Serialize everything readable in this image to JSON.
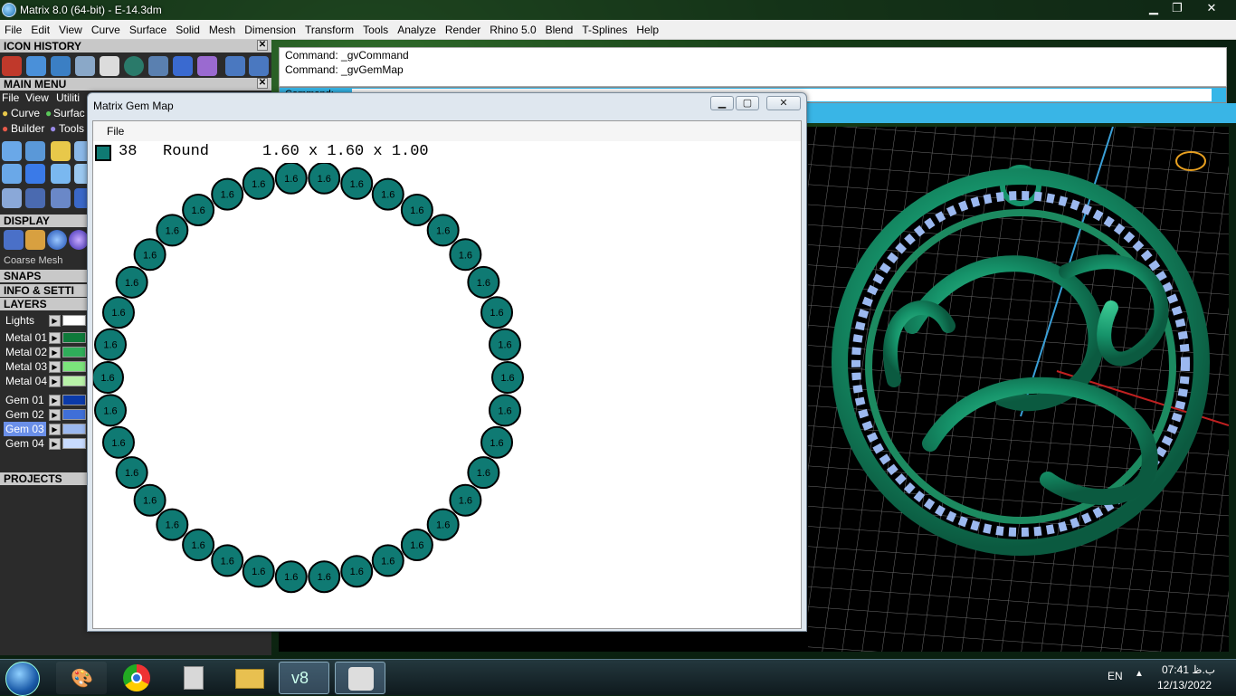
{
  "window": {
    "title": "Matrix 8.0 (64-bit) - E-14.3dm",
    "min": "▁",
    "max": "❐",
    "close": "✕"
  },
  "menubar": [
    "File",
    "Edit",
    "View",
    "Curve",
    "Surface",
    "Solid",
    "Mesh",
    "Dimension",
    "Transform",
    "Tools",
    "Analyze",
    "Render",
    "Rhino 5.0",
    "Blend",
    "T-Splines",
    "Help"
  ],
  "panel": {
    "icon_history": "ICON HISTORY",
    "main_menu": "MAIN MENU",
    "main_menu_items": [
      "File",
      "View",
      "Utiliti"
    ],
    "row2": [
      "Curve",
      "Surfac"
    ],
    "row3": [
      "Builder",
      "Tools"
    ],
    "display": "DISPLAY",
    "coarse": "Coarse Mesh",
    "snaps": "SNAPS",
    "info": "INFO & SETTI",
    "layers": "LAYERS",
    "projects": "PROJECTS",
    "layer_list": [
      {
        "name": "Lights",
        "color": "#ffffff"
      },
      {
        "name": "Metal 01",
        "color": "#0e7a3a"
      },
      {
        "name": "Metal 02",
        "color": "#2fae5a"
      },
      {
        "name": "Metal 03",
        "color": "#7be37b"
      },
      {
        "name": "Metal 04",
        "color": "#b8f2a8"
      },
      {
        "name": "Gem 01",
        "color": "#0b3aa8"
      },
      {
        "name": "Gem 02",
        "color": "#3f6fd8"
      },
      {
        "name": "Gem 03",
        "color": "#9bb8ef"
      },
      {
        "name": "Gem 04",
        "color": "#c8dbff"
      }
    ]
  },
  "command": {
    "line1": "Command: _gvCommand",
    "line2": "Command: _gvGemMap",
    "prompt": "Command:"
  },
  "gemmap": {
    "title": "Matrix Gem Map",
    "menu_file": "File",
    "count": "38",
    "shape": "Round",
    "size": "1.60 x 1.60 x 1.00",
    "gem_label": "1.6",
    "gem_color": "#0f7a73"
  },
  "taskbar": {
    "lang": "EN",
    "time": "07:41 ب.ظ",
    "date": "12/13/2022"
  }
}
